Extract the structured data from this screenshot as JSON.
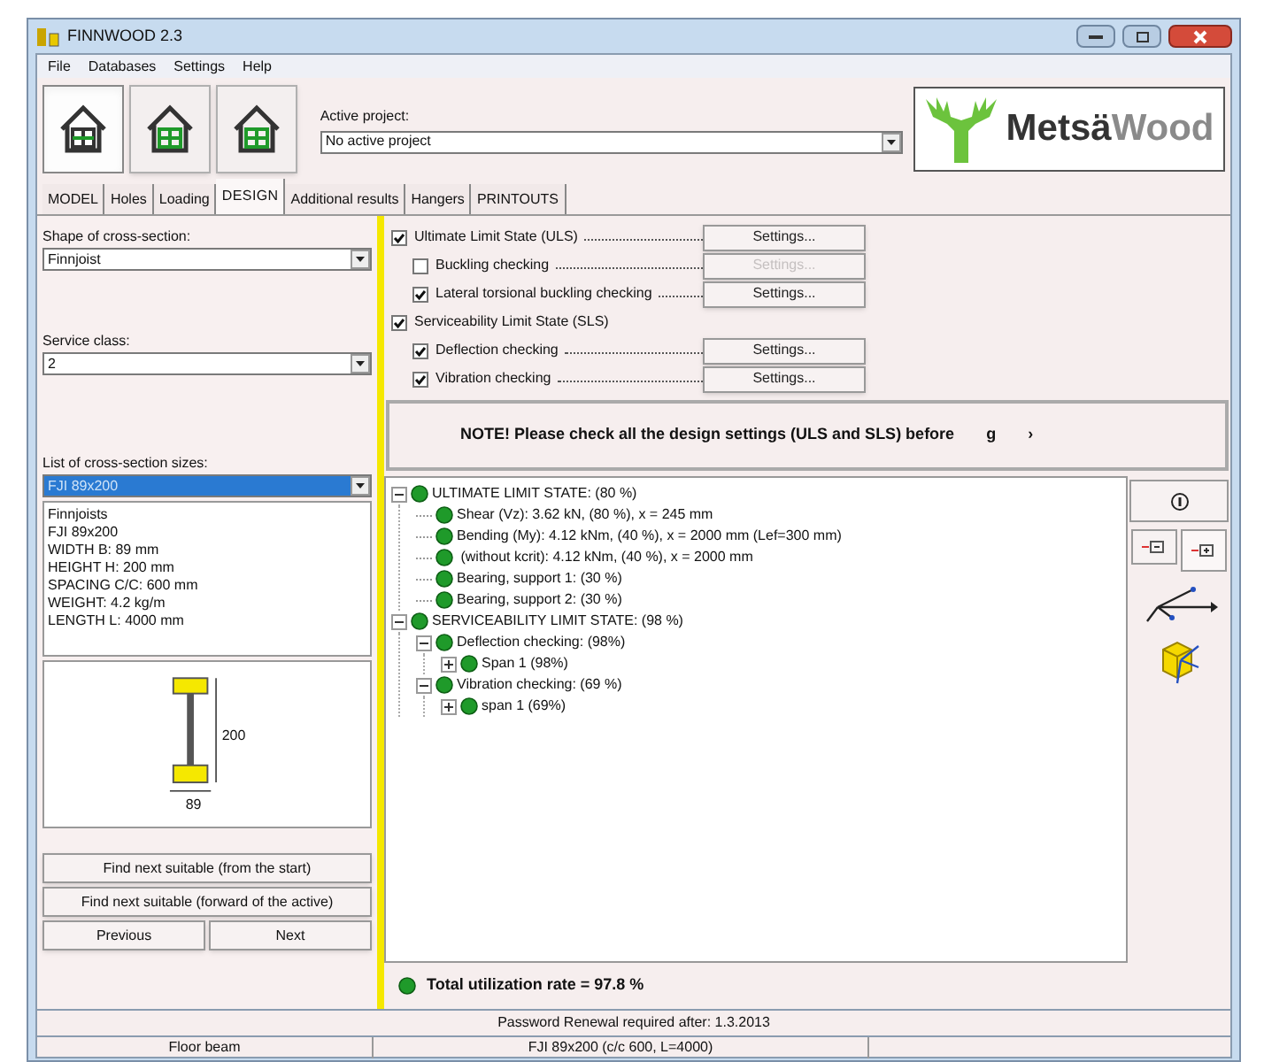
{
  "window": {
    "title": "FINNWOOD 2.3"
  },
  "menu": [
    "File",
    "Databases",
    "Settings",
    "Help"
  ],
  "toolbar": {
    "buttons": [
      {
        "selected": true
      },
      {
        "selected": false
      },
      {
        "selected": false
      }
    ],
    "active_project": {
      "label": "Active project:",
      "value": "No active project"
    }
  },
  "logo": {
    "part_1": "Metsä",
    "part_2": "Wood"
  },
  "tabs": [
    {
      "label": "MODEL",
      "selected": false
    },
    {
      "label": "Holes",
      "selected": false
    },
    {
      "label": "Loading",
      "selected": false
    },
    {
      "label": "DESIGN",
      "selected": true
    },
    {
      "label": "Additional results",
      "selected": false
    },
    {
      "label": "Hangers",
      "selected": false
    },
    {
      "label": "PRINTOUTS",
      "selected": false
    }
  ],
  "left_panel": {
    "shape": {
      "label": "Shape of cross-section:",
      "value": "Finnjoist"
    },
    "service_class": {
      "label": "Service class:",
      "value": "2"
    },
    "sizes": {
      "label": "List of cross-section sizes:",
      "value": "FJI 89x200"
    },
    "info_lines": [
      "Finnjoists",
      "FJI 89x200",
      "WIDTH B: 89 mm",
      "HEIGHT H: 200 mm",
      "SPACING C/C: 600 mm",
      "WEIGHT: 4.2 kg/m",
      "LENGTH L: 4000 mm"
    ],
    "drawing": {
      "height_label": "200",
      "width_label": "89"
    },
    "buttons": [
      "Find next suitable (from the start)",
      "Find next suitable (forward of the active)"
    ],
    "nav_buttons": [
      "Previous",
      "Next"
    ]
  },
  "checks": [
    {
      "label": "Ultimate Limit State (ULS)",
      "checked": true,
      "settings": {
        "label": "Settings...",
        "disabled": false
      },
      "children": [
        {
          "label": "Buckling checking",
          "checked": false,
          "settings": {
            "label": "Settings...",
            "disabled": true
          }
        },
        {
          "label": "Lateral torsional buckling checking",
          "checked": true,
          "settings": {
            "label": "Settings...",
            "disabled": false
          }
        }
      ]
    },
    {
      "label": "Serviceability Limit State (SLS)",
      "checked": true,
      "children": [
        {
          "label": "Deflection checking",
          "checked": true,
          "settings": {
            "label": "Settings...",
            "disabled": false
          }
        },
        {
          "label": "Vibration checking",
          "checked": true,
          "settings": {
            "label": "Settings...",
            "disabled": false
          }
        }
      ]
    }
  ],
  "note": {
    "text": "NOTE! Please check all the design settings (ULS and SLS) before",
    "tail": [
      "g",
      "›"
    ]
  },
  "results": [
    {
      "label": "ULTIMATE LIMIT STATE: (80 %)",
      "expanded": true,
      "children": [
        {
          "label": "Shear (Vz): 3.62 kN, (80 %), x = 245 mm"
        },
        {
          "label": "Bending (My): 4.12 kNm, (40 %), x = 2000 mm (Lef=300 mm)"
        },
        {
          "label": " (without kcrit): 4.12 kNm, (40 %), x = 2000 mm"
        },
        {
          "label": "Bearing, support 1: (30 %)"
        },
        {
          "label": "Bearing, support 2: (30 %)"
        }
      ]
    },
    {
      "label": "SERVICEABILITY LIMIT STATE: (98 %)",
      "expanded": true,
      "children": [
        {
          "label": "Deflection checking: (98%)",
          "expanded": true,
          "children": [
            {
              "label": "Span 1 (98%)",
              "expanded": false
            }
          ]
        },
        {
          "label": "Vibration checking: (69 %)",
          "expanded": true,
          "children": [
            {
              "label": "span 1 (69%)",
              "expanded": false
            }
          ]
        }
      ]
    }
  ],
  "total": "Total utilization rate = 97.8 %",
  "status": {
    "message": "Password Renewal required after: 1.3.2013",
    "cells": [
      "Floor beam",
      "FJI 89x200 (c/c 600, L=4000)"
    ]
  }
}
